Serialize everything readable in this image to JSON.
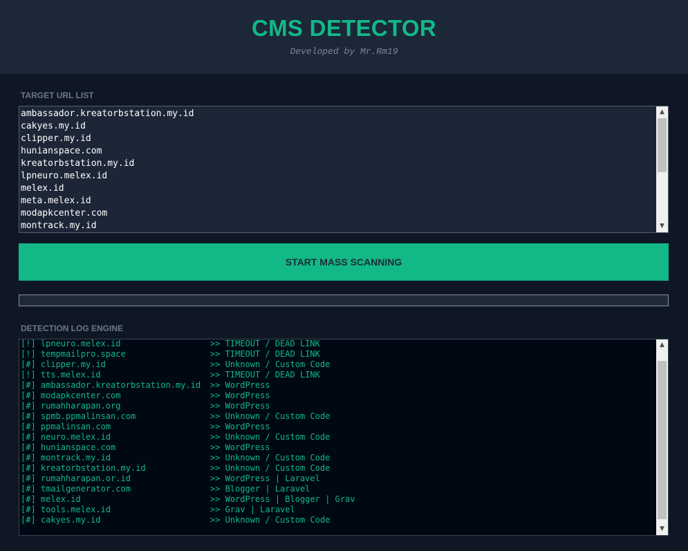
{
  "header": {
    "title": "CMS DETECTOR",
    "subtitle": "Developed by Mr.Rm19"
  },
  "target": {
    "label": "TARGET URL LIST",
    "urls": [
      "ambassador.kreatorbstation.my.id",
      "cakyes.my.id",
      "clipper.my.id",
      "hunianspace.com",
      "kreatorbstation.my.id",
      "lpneuro.melex.id",
      "melex.id",
      "meta.melex.id",
      "modapkcenter.com",
      "montrack.my.id"
    ]
  },
  "scan": {
    "button_label": "START MASS SCANNING",
    "progress": 0
  },
  "log": {
    "label": "DETECTION LOG ENGINE",
    "entries": [
      {
        "prefix": "[!]",
        "domain": "lpneuro.melex.id",
        "result": ">> TIMEOUT / DEAD LINK"
      },
      {
        "prefix": "[!]",
        "domain": "tempmailpro.space",
        "result": ">> TIMEOUT / DEAD LINK"
      },
      {
        "prefix": "[#]",
        "domain": "clipper.my.id",
        "result": ">> Unknown / Custom Code"
      },
      {
        "prefix": "[!]",
        "domain": "tts.melex.id",
        "result": ">> TIMEOUT / DEAD LINK"
      },
      {
        "prefix": "[#]",
        "domain": "ambassador.kreatorbstation.my.id",
        "result": ">> WordPress"
      },
      {
        "prefix": "[#]",
        "domain": "modapkcenter.com",
        "result": ">> WordPress"
      },
      {
        "prefix": "[#]",
        "domain": "rumahharapan.org",
        "result": ">> WordPress"
      },
      {
        "prefix": "[#]",
        "domain": "spmb.ppmalinsan.com",
        "result": ">> Unknown / Custom Code"
      },
      {
        "prefix": "[#]",
        "domain": "ppmalinsan.com",
        "result": ">> WordPress"
      },
      {
        "prefix": "[#]",
        "domain": "neuro.melex.id",
        "result": ">> Unknown / Custom Code"
      },
      {
        "prefix": "[#]",
        "domain": "hunianspace.com",
        "result": ">> WordPress"
      },
      {
        "prefix": "[#]",
        "domain": "montrack.my.id",
        "result": ">> Unknown / Custom Code"
      },
      {
        "prefix": "[#]",
        "domain": "kreatorbstation.my.id",
        "result": ">> Unknown / Custom Code"
      },
      {
        "prefix": "[#]",
        "domain": "rumahharapan.or.id",
        "result": ">> WordPress | Laravel"
      },
      {
        "prefix": "[#]",
        "domain": "tmailgenerator.com",
        "result": ">> Blogger | Laravel"
      },
      {
        "prefix": "[#]",
        "domain": "melex.id",
        "result": ">> WordPress | Blogger | Grav"
      },
      {
        "prefix": "[#]",
        "domain": "tools.melex.id",
        "result": ">> Grav | Laravel"
      },
      {
        "prefix": "[#]",
        "domain": "cakyes.my.id",
        "result": ">> Unknown / Custom Code"
      }
    ]
  },
  "icons": {
    "scroll_up": "scroll-up-arrow-icon",
    "scroll_down": "scroll-down-arrow-icon"
  },
  "colors": {
    "accent": "#12b886",
    "header_bg": "#1c2738",
    "page_bg": "#0f1725",
    "log_bg": "#000814"
  }
}
